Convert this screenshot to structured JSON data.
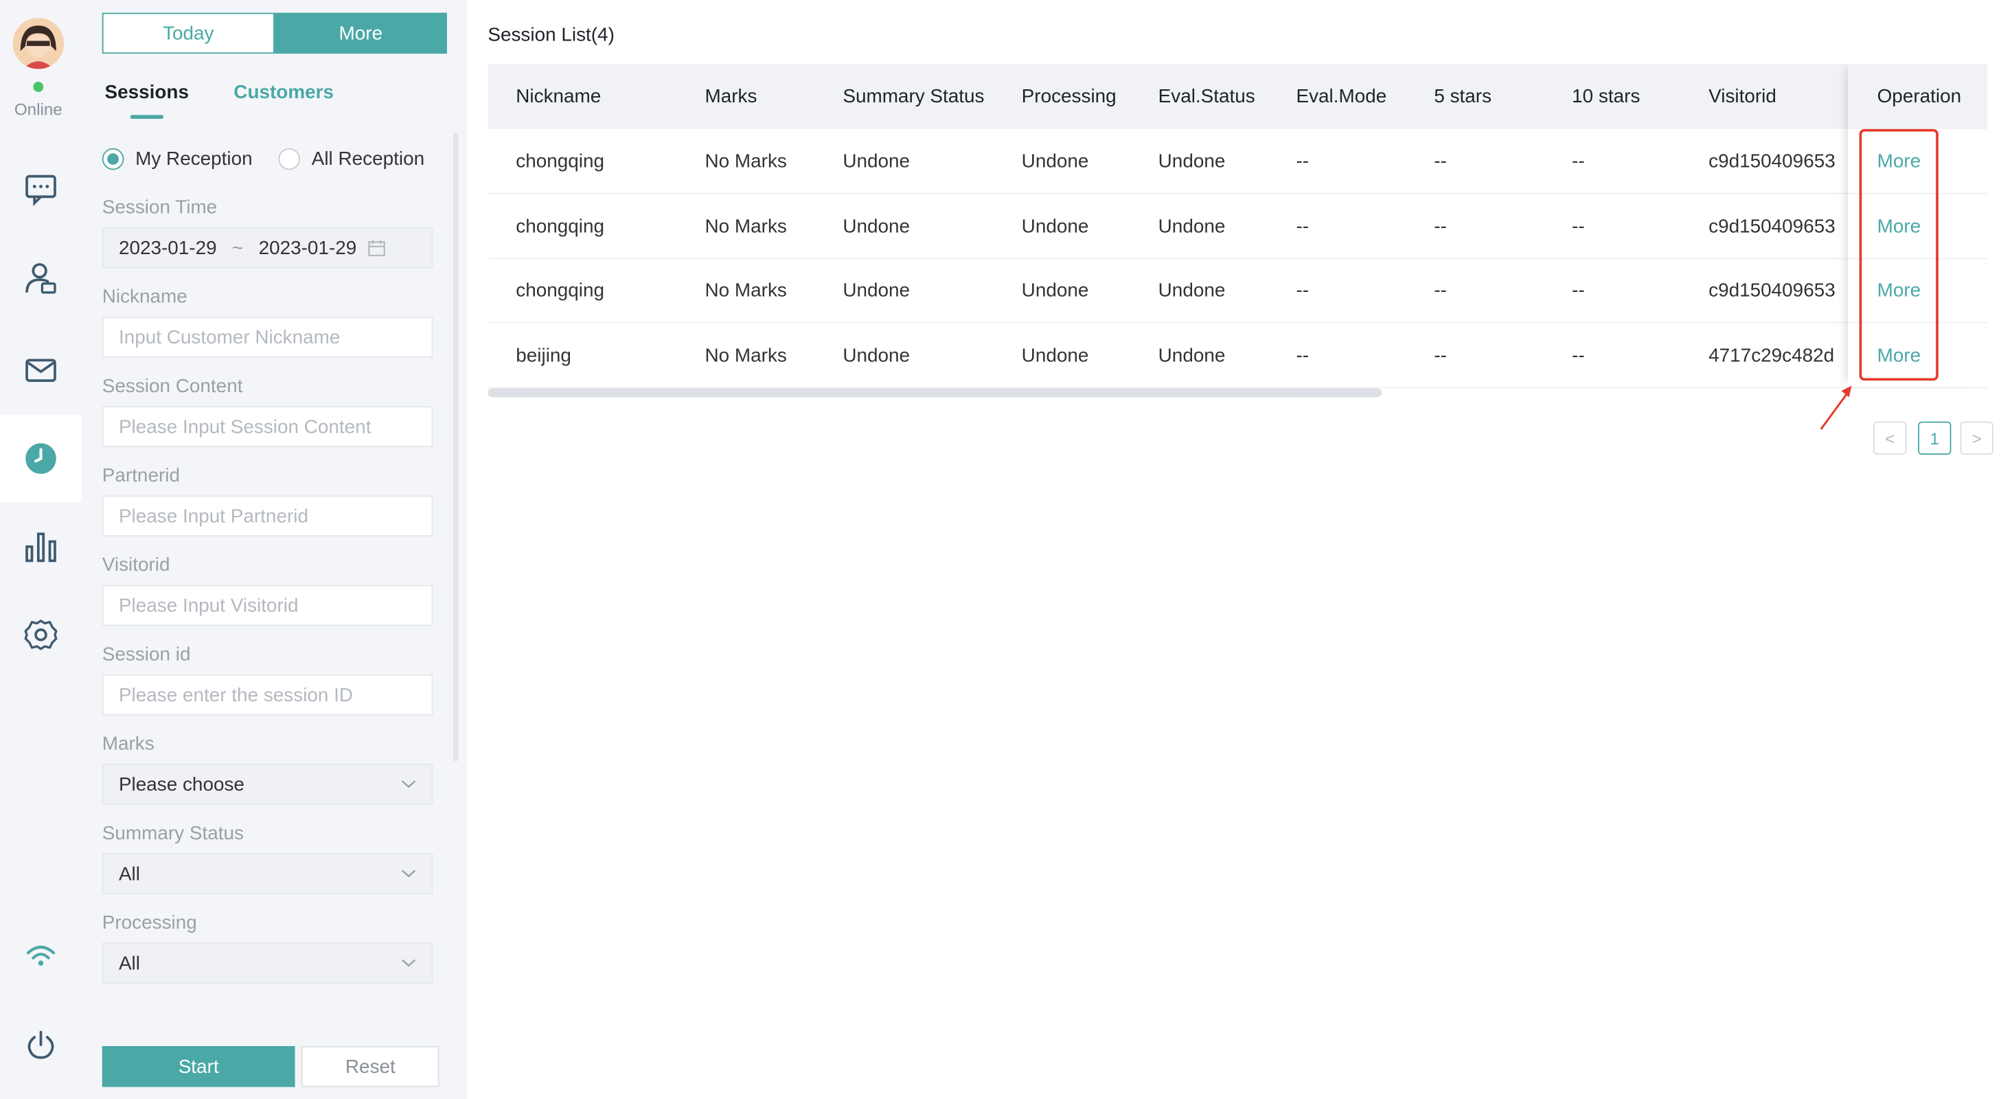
{
  "sidebar": {
    "status": "Online"
  },
  "panel": {
    "tabs": {
      "today": "Today",
      "more": "More"
    },
    "subtabs": {
      "sessions": "Sessions",
      "customers": "Customers"
    },
    "reception": {
      "mine": "My Reception",
      "all": "All Reception"
    },
    "session_time": {
      "label": "Session Time",
      "start": "2023-01-29",
      "sep": "~",
      "end": "2023-01-29"
    },
    "nickname": {
      "label": "Nickname",
      "placeholder": "Input Customer Nickname"
    },
    "session_content": {
      "label": "Session Content",
      "placeholder": "Please Input Session Content"
    },
    "partnerid": {
      "label": "Partnerid",
      "placeholder": "Please Input Partnerid"
    },
    "visitorid": {
      "label": "Visitorid",
      "placeholder": "Please Input Visitorid"
    },
    "session_id": {
      "label": "Session id",
      "placeholder": "Please enter the session ID"
    },
    "marks": {
      "label": "Marks",
      "value": "Please choose"
    },
    "summary_status": {
      "label": "Summary Status",
      "value": "All"
    },
    "processing": {
      "label": "Processing",
      "value": "All"
    },
    "start_label": "Start",
    "reset_label": "Reset"
  },
  "main": {
    "title": "Session List(4)",
    "columns": [
      "Nickname",
      "Marks",
      "Summary Status",
      "Processing",
      "Eval.Status",
      "Eval.Mode",
      "5 stars",
      "10 stars",
      "Visitorid",
      "Operation"
    ],
    "rows": [
      [
        "chongqing",
        "No Marks",
        "Undone",
        "Undone",
        "Undone",
        "--",
        "--",
        "--",
        "c9d150409653",
        "More"
      ],
      [
        "chongqing",
        "No Marks",
        "Undone",
        "Undone",
        "Undone",
        "--",
        "--",
        "--",
        "c9d150409653",
        "More"
      ],
      [
        "chongqing",
        "No Marks",
        "Undone",
        "Undone",
        "Undone",
        "--",
        "--",
        "--",
        "c9d150409653",
        "More"
      ],
      [
        "beijing",
        "No Marks",
        "Undone",
        "Undone",
        "Undone",
        "--",
        "--",
        "--",
        "4717c29c482d",
        "More"
      ]
    ],
    "pagination": {
      "prev": "<",
      "current": "1",
      "next": ">"
    }
  },
  "colors": {
    "accent": "#4aa8a6",
    "highlight": "#e53b2c",
    "online": "#4cc36b"
  }
}
